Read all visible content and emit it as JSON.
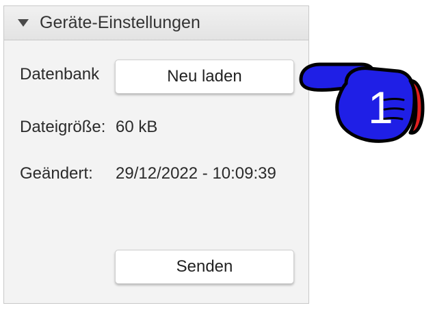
{
  "panel": {
    "title": "Geräte-Einstellungen",
    "collapse_icon": "triangle-down-icon"
  },
  "database": {
    "label": "Datenbank",
    "reload_button": "Neu laden"
  },
  "filesize": {
    "label": "Dateigröße:",
    "value": "60 kB"
  },
  "modified": {
    "label": "Geändert:",
    "value": "29/12/2022 - 10:09:39"
  },
  "send_button": "Senden",
  "pointer": {
    "icon": "pointing-hand-icon",
    "number": "1",
    "colors": {
      "hand": "#1f1fe6",
      "cuff": "#e02020",
      "outline": "#000000"
    }
  }
}
